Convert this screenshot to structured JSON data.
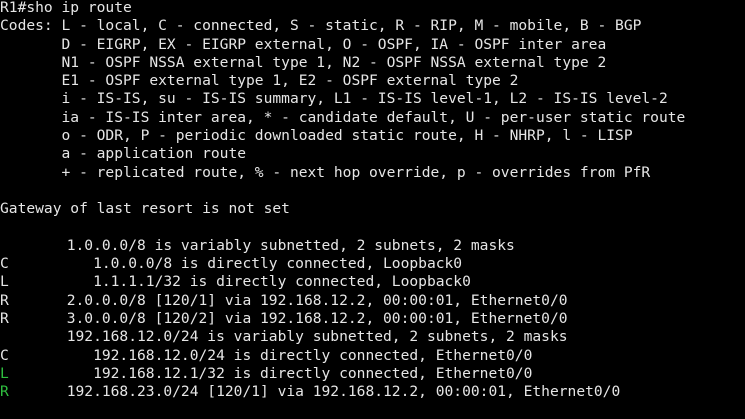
{
  "terminal": {
    "prompt": "R1#",
    "command": "sho ip route",
    "codes_header": [
      "Codes: L - local, C - connected, S - static, R - RIP, M - mobile, B - BGP",
      "       D - EIGRP, EX - EIGRP external, O - OSPF, IA - OSPF inter area",
      "       N1 - OSPF NSSA external type 1, N2 - OSPF NSSA external type 2",
      "       E1 - OSPF external type 1, E2 - OSPF external type 2",
      "       i - IS-IS, su - IS-IS summary, L1 - IS-IS level-1, L2 - IS-IS level-2",
      "       ia - IS-IS inter area, * - candidate default, U - per-user static route",
      "       o - ODR, P - periodic downloaded static route, H - NHRP, l - LISP",
      "       a - application route",
      "       + - replicated route, % - next hop override, p - overrides from PfR"
    ],
    "gateway_line": "Gateway of last resort is not set",
    "routes": [
      {
        "code": "",
        "text": "      1.0.0.0/8 is variably subnetted, 2 subnets, 2 masks"
      },
      {
        "code": "C",
        "text": "         1.0.0.0/8 is directly connected, Loopback0"
      },
      {
        "code": "L",
        "text": "         1.1.1.1/32 is directly connected, Loopback0"
      },
      {
        "code": "R",
        "text": "      2.0.0.0/8 [120/1] via 192.168.12.2, 00:00:01, Ethernet0/0"
      },
      {
        "code": "R",
        "text": "      3.0.0.0/8 [120/2] via 192.168.12.2, 00:00:01, Ethernet0/0"
      },
      {
        "code": "",
        "text": "      192.168.12.0/24 is variably subnetted, 2 subnets, 2 masks"
      },
      {
        "code": "C",
        "text": "         192.168.12.0/24 is directly connected, Ethernet0/0"
      },
      {
        "code": "L",
        "text": "         192.168.12.1/32 is directly connected, Ethernet0/0"
      },
      {
        "code": "R",
        "text": "      192.168.23.0/24 [120/1] via 192.168.12.2, 00:00:01, Ethernet0/0"
      }
    ],
    "colors": {
      "background": "#000000",
      "text": "#e6e6e6",
      "highlight": "#2fbf3f"
    }
  }
}
